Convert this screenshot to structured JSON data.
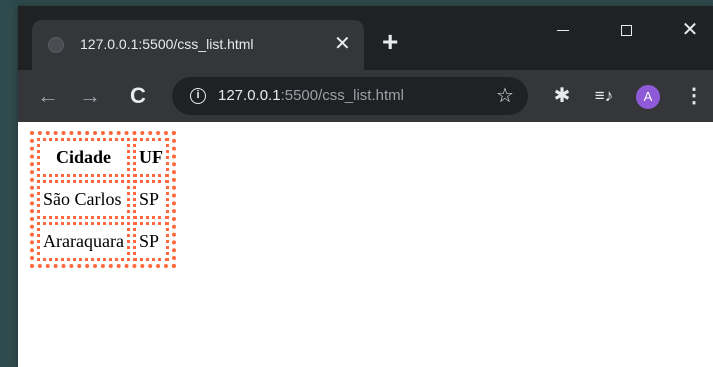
{
  "colors": {
    "border_dotted": "#ff6a3d",
    "avatar_bg": "#8e5ad8",
    "chrome_dark": "#1f2123",
    "chrome_tab": "#35363a"
  },
  "browser": {
    "tab": {
      "title": "127.0.0.1:5500/css_list.html",
      "close_glyph": "✕",
      "favicon": "globe-icon"
    },
    "new_tab_glyph": "+",
    "window_controls": {
      "minimize": "minimize-icon",
      "maximize": "maximize-icon",
      "close_glyph": "✕"
    },
    "toolbar": {
      "back_glyph": "←",
      "forward_glyph": "→",
      "reload_glyph": "C",
      "info_glyph": "i",
      "url_host": "127.0.0.1",
      "url_path": ":5500/css_list.html",
      "star_glyph": "☆",
      "extensions_glyph": "✱",
      "media_glyph": "≡♪",
      "avatar_letter": "A",
      "menu_glyph": "⋮"
    }
  },
  "page": {
    "table": {
      "headers": [
        "Cidade",
        "UF"
      ],
      "rows": [
        [
          "São Carlos",
          "SP"
        ],
        [
          "Araraquara",
          "SP"
        ]
      ]
    }
  }
}
